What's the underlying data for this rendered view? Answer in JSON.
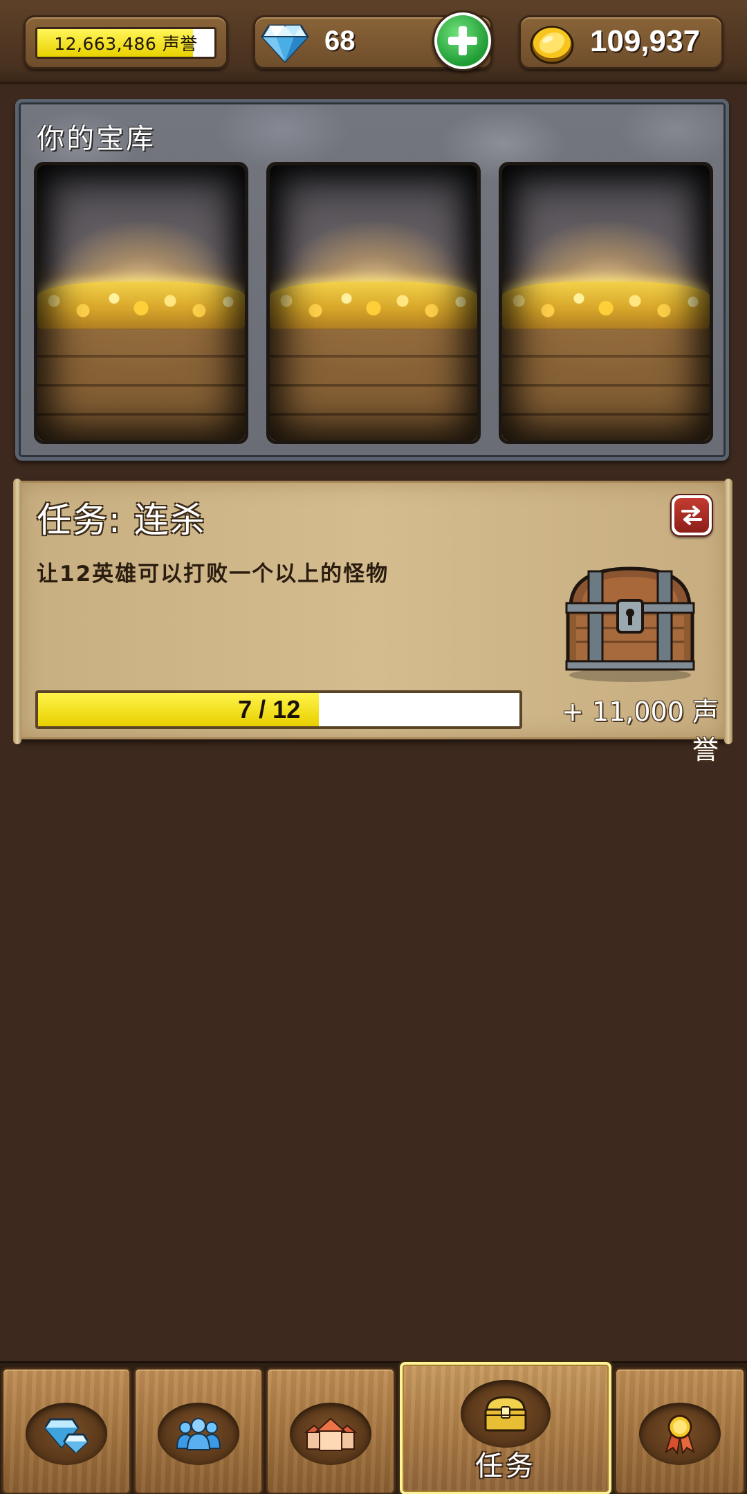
{
  "topbar": {
    "reputation": {
      "value_text": "12,663,486 声誉",
      "fill_percent": 88
    },
    "gems": {
      "count": "68",
      "icon": "diamond-icon",
      "add_icon": "plus-icon"
    },
    "gold": {
      "count": "109,937",
      "icon": "gold-coin-icon"
    }
  },
  "vault": {
    "title": "你的宝库",
    "slots": [
      {
        "name": "gold-pile-slot-1"
      },
      {
        "name": "gold-pile-slot-2"
      },
      {
        "name": "gold-pile-slot-3"
      }
    ]
  },
  "quest": {
    "title": "任务: 连杀",
    "description": "让12英雄可以打败一个以上的怪物",
    "progress_text": "7 / 12",
    "progress": {
      "current": 7,
      "total": 12
    },
    "reward": "+ 11,000 声誉",
    "reward_icon": "treasure-chest-icon",
    "swap_icon": "swap-arrows-icon"
  },
  "bottom_nav": {
    "items": [
      {
        "icon": "gem-shop-icon",
        "label": ""
      },
      {
        "icon": "heroes-icon",
        "label": ""
      },
      {
        "icon": "buildings-icon",
        "label": ""
      },
      {
        "icon": "quest-chest-icon",
        "label": "任务",
        "active": true
      },
      {
        "icon": "achievement-medal-icon",
        "label": ""
      }
    ]
  },
  "colors": {
    "background": "#3d291e",
    "progress_fill": "#e8d000",
    "add_button": "#1f9c34",
    "swap_button": "#b22f26"
  }
}
